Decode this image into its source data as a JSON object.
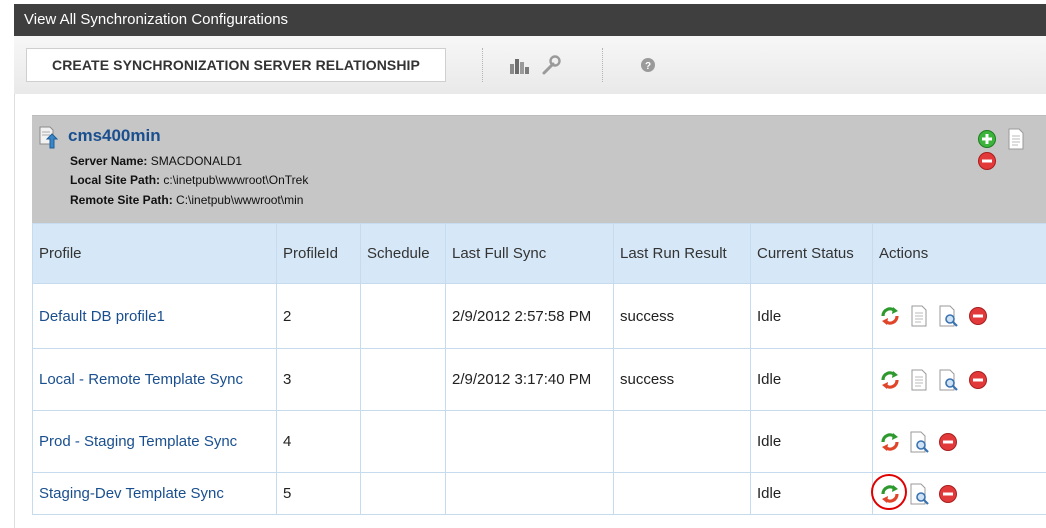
{
  "window": {
    "title": "View All Synchronization Configurations"
  },
  "toolbar": {
    "create_label": "CREATE SYNCHRONIZATION SERVER RELATIONSHIP",
    "icons": [
      "statistics-icon",
      "wrench-icon",
      "help-icon"
    ]
  },
  "server": {
    "name": "cms400min",
    "server_name_label": "Server Name:",
    "server_name_value": "SMACDONALD1",
    "local_path_label": "Local Site Path:",
    "local_path_value": "c:\\inetpub\\wwwroot\\OnTrek",
    "remote_path_label": "Remote Site Path:",
    "remote_path_value": "C:\\inetpub\\wwwroot\\min",
    "action_icons": [
      "add-icon",
      "document-icon",
      "delete-icon"
    ]
  },
  "table": {
    "headers": {
      "profile": "Profile",
      "profile_id": "ProfileId",
      "schedule": "Schedule",
      "last_full_sync": "Last Full Sync",
      "last_run_result": "Last Run Result",
      "current_status": "Current Status",
      "actions": "Actions"
    },
    "rows": [
      {
        "profile": "Default DB profile1",
        "profile_id": "2",
        "schedule": "",
        "last_full_sync": "2/9/2012 2:57:58 PM",
        "last_run_result": "success",
        "current_status": "Idle",
        "actions": [
          "sync-icon",
          "document-icon",
          "preview-icon",
          "delete-icon"
        ]
      },
      {
        "profile": "Local - Remote Template Sync",
        "profile_id": "3",
        "schedule": "",
        "last_full_sync": "2/9/2012 3:17:40 PM",
        "last_run_result": "success",
        "current_status": "Idle",
        "actions": [
          "sync-icon",
          "document-icon",
          "preview-icon",
          "delete-icon"
        ]
      },
      {
        "profile": "Prod - Staging Template Sync",
        "profile_id": "4",
        "schedule": "",
        "last_full_sync": "",
        "last_run_result": "",
        "current_status": "Idle",
        "actions": [
          "sync-icon",
          "preview-icon",
          "delete-icon"
        ]
      },
      {
        "profile": "Staging-Dev Template Sync",
        "profile_id": "5",
        "schedule": "",
        "last_full_sync": "",
        "last_run_result": "",
        "current_status": "Idle",
        "actions": [
          "sync-icon",
          "preview-icon",
          "delete-icon"
        ]
      }
    ]
  },
  "colors": {
    "title_bar": "#3f3f3f",
    "link": "#1a4f8f",
    "header_bg": "#d6e8f7",
    "highlight": "#e00000"
  }
}
